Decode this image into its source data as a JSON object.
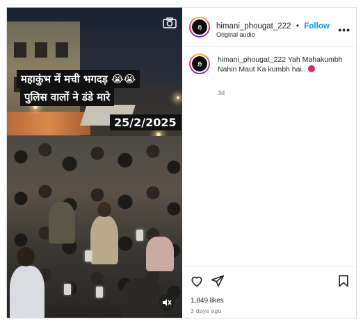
{
  "video": {
    "caption_line1": "महाकुंभ में मची भगदड़ 😭😭",
    "caption_line2": "पुलिस वालों ने डंडे मारे",
    "date_overlay": "25/2/2025"
  },
  "header": {
    "username": "himani_phougat_222",
    "separator": "•",
    "follow_label": "Follow",
    "audio_label": "Original audio",
    "more_label": "•••"
  },
  "caption": {
    "username": "himani_phougat_222",
    "text": "Yah Mahakumbh Nahin Maut Ka kumbh hai..",
    "time": "3d"
  },
  "footer": {
    "likes": "1,849 likes",
    "date": "3 days ago"
  },
  "icons": {
    "camera": "camera-icon",
    "mute": "speaker-muted-icon",
    "like": "heart-icon",
    "share": "share-icon",
    "save": "bookmark-icon",
    "more": "more-dots-icon"
  },
  "colors": {
    "accent": "#0095f6",
    "secondary_text": "#737373",
    "border": "#dbdbdb"
  }
}
